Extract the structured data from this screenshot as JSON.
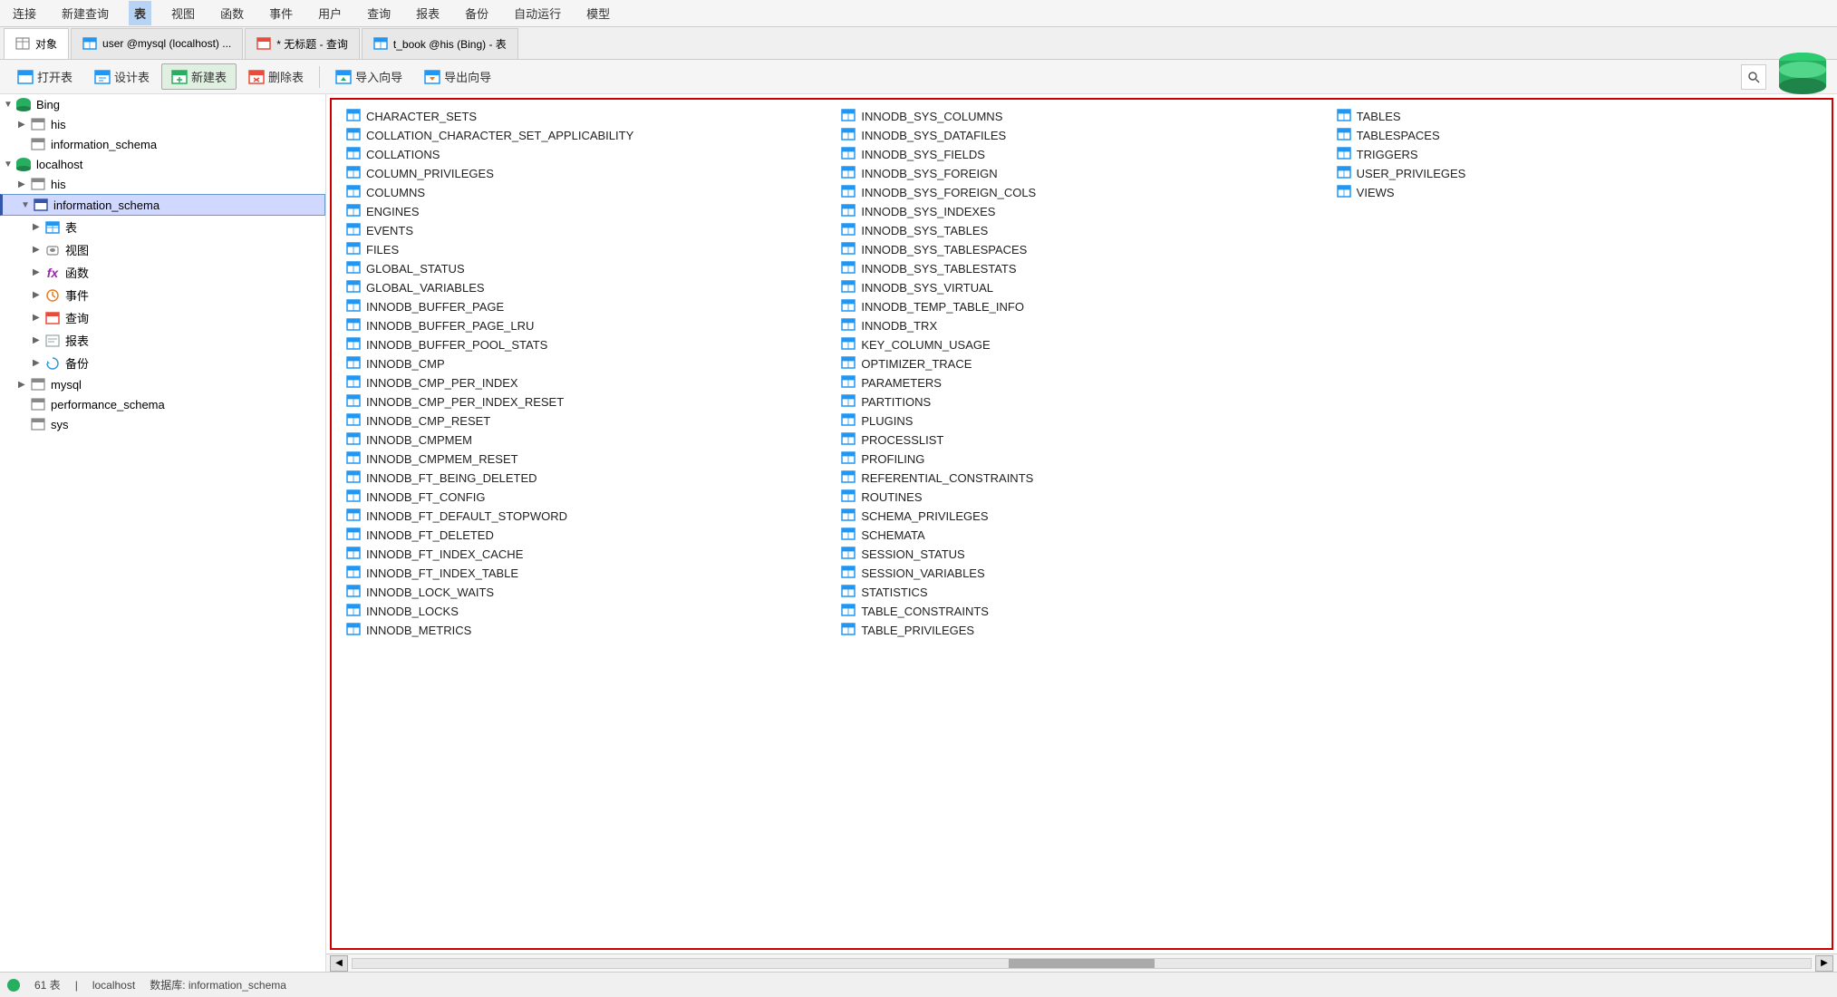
{
  "menu": {
    "items": [
      "连接",
      "新建查询",
      "表",
      "视图",
      "函数",
      "事件",
      "用户",
      "查询",
      "报表",
      "备份",
      "自动运行",
      "模型"
    ]
  },
  "tabs": [
    {
      "label": "对象",
      "icon": "object"
    },
    {
      "label": "user @mysql (localhost) ...",
      "icon": "table",
      "prefix": "user @mysql"
    },
    {
      "label": "* 无标题 - 查询",
      "icon": "query"
    },
    {
      "label": "t_book @his (Bing) - 表",
      "icon": "table"
    }
  ],
  "actions": [
    "打开表",
    "设计表",
    "新建表",
    "删除表",
    "导入向导",
    "导出向导"
  ],
  "sidebar": {
    "tree": [
      {
        "level": 0,
        "label": "Bing",
        "type": "server",
        "expanded": true,
        "arrow": "▼"
      },
      {
        "level": 1,
        "label": "his",
        "type": "db",
        "expanded": false,
        "arrow": "▶"
      },
      {
        "level": 1,
        "label": "information_schema",
        "type": "db",
        "expanded": false,
        "arrow": ""
      },
      {
        "level": 0,
        "label": "localhost",
        "type": "server",
        "expanded": true,
        "arrow": "▼"
      },
      {
        "level": 1,
        "label": "his",
        "type": "db",
        "expanded": false,
        "arrow": "▶"
      },
      {
        "level": 1,
        "label": "information_schema",
        "type": "db",
        "expanded": true,
        "arrow": "▼",
        "selected": true
      },
      {
        "level": 2,
        "label": "表",
        "type": "table-group",
        "expanded": false,
        "arrow": "▶"
      },
      {
        "level": 2,
        "label": "视图",
        "type": "view-group",
        "expanded": false,
        "arrow": "▶"
      },
      {
        "level": 2,
        "label": "函数",
        "type": "func-group",
        "expanded": false,
        "arrow": "▶"
      },
      {
        "level": 2,
        "label": "事件",
        "type": "event-group",
        "expanded": false,
        "arrow": "▶"
      },
      {
        "level": 2,
        "label": "查询",
        "type": "query-group",
        "expanded": false,
        "arrow": "▶"
      },
      {
        "level": 2,
        "label": "报表",
        "type": "report-group",
        "expanded": false,
        "arrow": "▶"
      },
      {
        "level": 2,
        "label": "备份",
        "type": "backup-group",
        "expanded": false,
        "arrow": "▶"
      },
      {
        "level": 1,
        "label": "mysql",
        "type": "db",
        "expanded": false,
        "arrow": "▶"
      },
      {
        "level": 1,
        "label": "performance_schema",
        "type": "db",
        "expanded": false,
        "arrow": ""
      },
      {
        "level": 1,
        "label": "sys",
        "type": "db",
        "expanded": false,
        "arrow": ""
      }
    ]
  },
  "tables": {
    "col1": [
      "CHARACTER_SETS",
      "COLLATION_CHARACTER_SET_APPLICABILITY",
      "COLLATIONS",
      "COLUMN_PRIVILEGES",
      "COLUMNS",
      "ENGINES",
      "EVENTS",
      "FILES",
      "GLOBAL_STATUS",
      "GLOBAL_VARIABLES",
      "INNODB_BUFFER_PAGE",
      "INNODB_BUFFER_PAGE_LRU",
      "INNODB_BUFFER_POOL_STATS",
      "INNODB_CMP",
      "INNODB_CMP_PER_INDEX",
      "INNODB_CMP_PER_INDEX_RESET",
      "INNODB_CMP_RESET",
      "INNODB_CMPMEM",
      "INNODB_CMPMEM_RESET",
      "INNODB_FT_BEING_DELETED",
      "INNODB_FT_CONFIG",
      "INNODB_FT_DEFAULT_STOPWORD",
      "INNODB_FT_DELETED",
      "INNODB_FT_INDEX_CACHE",
      "INNODB_FT_INDEX_TABLE",
      "INNODB_LOCK_WAITS",
      "INNODB_LOCKS",
      "INNODB_METRICS"
    ],
    "col2": [
      "INNODB_SYS_COLUMNS",
      "INNODB_SYS_DATAFILES",
      "INNODB_SYS_FIELDS",
      "INNODB_SYS_FOREIGN",
      "INNODB_SYS_FOREIGN_COLS",
      "INNODB_SYS_INDEXES",
      "INNODB_SYS_TABLES",
      "INNODB_SYS_TABLESPACES",
      "INNODB_SYS_TABLESTATS",
      "INNODB_SYS_VIRTUAL",
      "INNODB_TEMP_TABLE_INFO",
      "INNODB_TRX",
      "KEY_COLUMN_USAGE",
      "OPTIMIZER_TRACE",
      "PARAMETERS",
      "PARTITIONS",
      "PLUGINS",
      "PROCESSLIST",
      "PROFILING",
      "REFERENTIAL_CONSTRAINTS",
      "ROUTINES",
      "SCHEMA_PRIVILEGES",
      "SCHEMATA",
      "SESSION_STATUS",
      "SESSION_VARIABLES",
      "STATISTICS",
      "TABLE_CONSTRAINTS",
      "TABLE_PRIVILEGES"
    ],
    "col3": [
      "TABLES",
      "TABLESPACES",
      "TRIGGERS",
      "USER_PRIVILEGES",
      "VIEWS",
      "",
      "",
      "",
      "",
      "",
      "",
      "",
      "",
      "",
      "",
      "",
      "",
      "",
      "",
      "",
      "",
      "",
      "",
      "",
      "",
      "",
      "",
      ""
    ]
  },
  "status": {
    "count": "61 表",
    "connection": "localhost",
    "database": "数据库: information_schema"
  }
}
